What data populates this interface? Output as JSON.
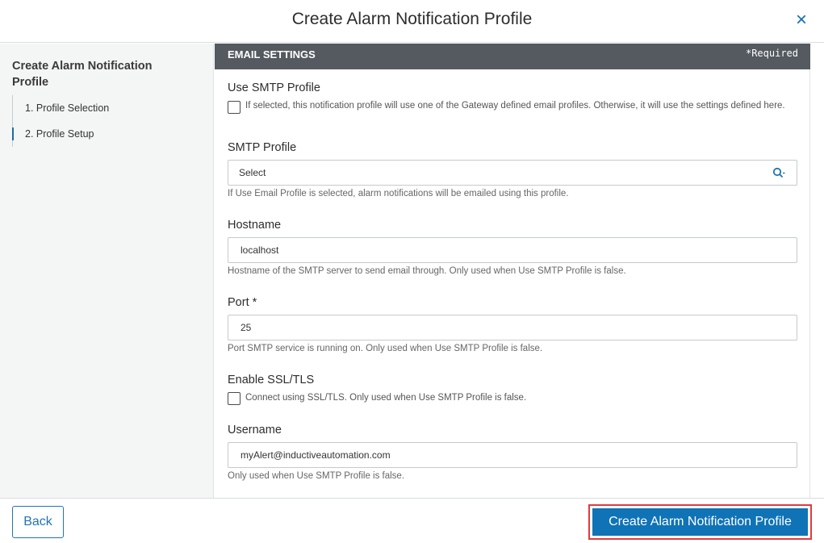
{
  "modal": {
    "title": "Create Alarm Notification Profile",
    "close_icon": "×"
  },
  "sidebar": {
    "title": "Create Alarm Notification Profile",
    "steps": [
      {
        "label": "1. Profile Selection",
        "active": false
      },
      {
        "label": "2. Profile Setup",
        "active": true
      }
    ]
  },
  "section": {
    "title": "EMAIL SETTINGS",
    "required_note": "*Required"
  },
  "fields": {
    "use_smtp_profile": {
      "label": "Use SMTP Profile",
      "checked": false,
      "description": "If selected, this notification profile will use one of the Gateway defined email profiles. Otherwise, it will use the settings defined here."
    },
    "smtp_profile": {
      "label": "SMTP Profile",
      "value": "Select",
      "icon": "search-icon",
      "help": "If Use Email Profile is selected, alarm notifications will be emailed using this profile."
    },
    "hostname": {
      "label": "Hostname",
      "value": "localhost",
      "help": "Hostname of the SMTP server to send email through. Only used when Use SMTP Profile is false."
    },
    "port": {
      "label": "Port *",
      "value": "25",
      "help": "Port SMTP service is running on. Only used when Use SMTP Profile is false."
    },
    "enable_ssl": {
      "label": "Enable SSL/TLS",
      "checked": false,
      "description": "Connect using SSL/TLS. Only used when Use SMTP Profile is false."
    },
    "username": {
      "label": "Username",
      "value": "myAlert@inductiveautomation.com",
      "help": "Only used when Use SMTP Profile is false."
    }
  },
  "footer": {
    "back_label": "Back",
    "create_label": "Create Alarm Notification Profile"
  },
  "colors": {
    "accent": "#0f73b6",
    "section_bar": "#545a60",
    "highlight_border": "#e03a3e"
  }
}
